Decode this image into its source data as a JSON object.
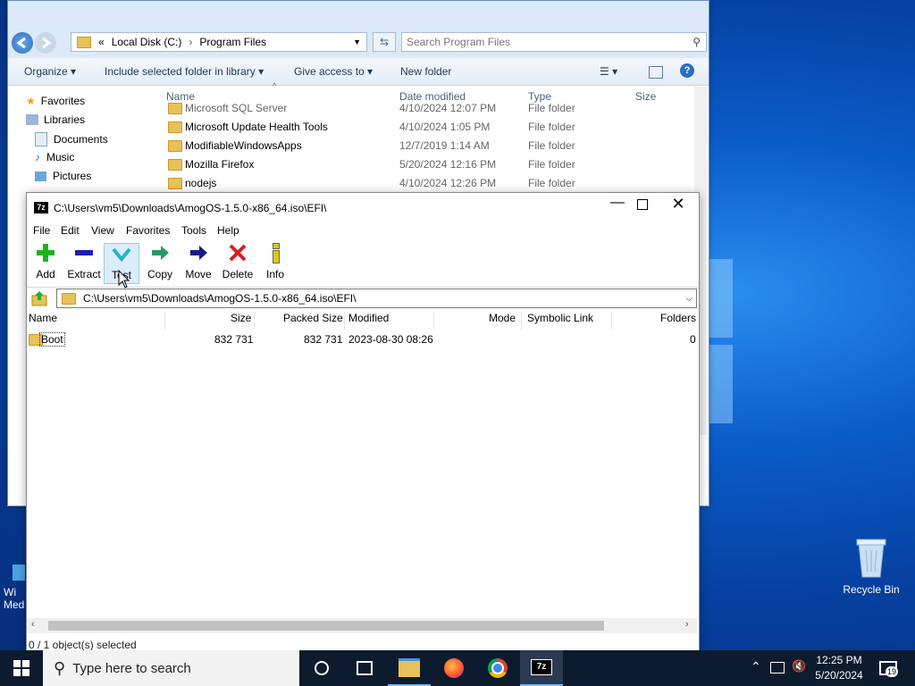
{
  "explorer": {
    "address": {
      "sep": "«",
      "crumb1": "Local Disk (C:)",
      "crumb2": "Program Files"
    },
    "search_placeholder": "Search Program Files",
    "commands": [
      "Organize",
      "Include selected folder in library",
      "Give access to",
      "New folder"
    ],
    "sidebar": {
      "favorites": "Favorites",
      "libraries": "Libraries",
      "documents": "Documents",
      "music": "Music",
      "pictures": "Pictures"
    },
    "columns": {
      "name": "Name",
      "date": "Date modified",
      "type": "Type",
      "size": "Size"
    },
    "files": [
      {
        "name": "Microsoft SQL Server",
        "date": "4/10/2024 12:07 PM",
        "type": "File folder"
      },
      {
        "name": "Microsoft Update Health Tools",
        "date": "4/10/2024 1:05 PM",
        "type": "File folder"
      },
      {
        "name": "ModifiableWindowsApps",
        "date": "12/7/2019 1:14 AM",
        "type": "File folder"
      },
      {
        "name": "Mozilla Firefox",
        "date": "5/20/2024 12:16 PM",
        "type": "File folder"
      },
      {
        "name": "nodejs",
        "date": "4/10/2024 12:26 PM",
        "type": "File folder"
      }
    ]
  },
  "zip": {
    "title": "C:\\Users\\vm5\\Downloads\\AmogOS-1.5.0-x86_64.iso\\EFI\\",
    "title_icon": "7z",
    "menu": [
      "File",
      "Edit",
      "View",
      "Favorites",
      "Tools",
      "Help"
    ],
    "toolbar": [
      "Add",
      "Extract",
      "Test",
      "Copy",
      "Move",
      "Delete",
      "Info"
    ],
    "path": "C:\\Users\\vm5\\Downloads\\AmogOS-1.5.0-x86_64.iso\\EFI\\",
    "columns": {
      "name": "Name",
      "size": "Size",
      "packed": "Packed Size",
      "modified": "Modified",
      "mode": "Mode",
      "symlink": "Symbolic Link",
      "folders": "Folders"
    },
    "rows": [
      {
        "name": "Boot",
        "size": "832 731",
        "packed": "832 731",
        "modified": "2023-08-30 08:26",
        "folders": "0"
      }
    ],
    "status": "0 / 1 object(s) selected"
  },
  "desktop": {
    "recycle_bin": "Recycle Bin",
    "partial_icon": "Wi\nMed"
  },
  "taskbar": {
    "search_placeholder": "Type here to search",
    "time": "12:25 PM",
    "date": "5/20/2024",
    "notifications": "19",
    "zip_icon": "7z"
  },
  "colors": {
    "accent": "#0078d7",
    "taskbar": "#0d1b2e",
    "explorer_bar": "#dbe9f8"
  }
}
